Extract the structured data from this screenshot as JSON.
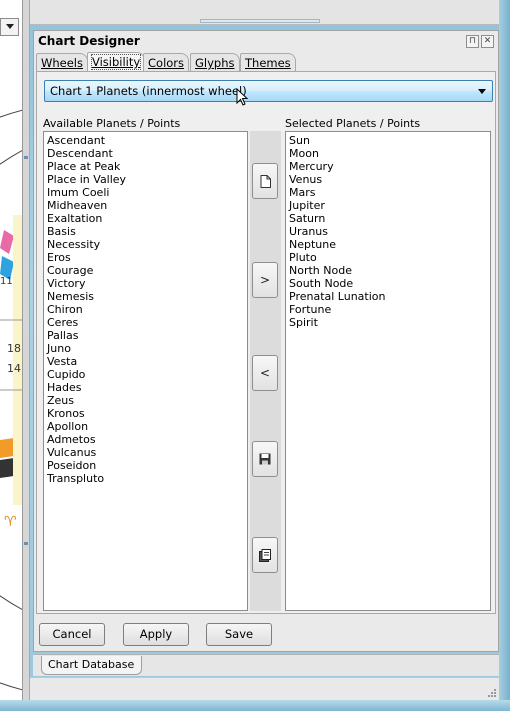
{
  "window": {
    "colors": {
      "frame": "#9bc8df",
      "select_accent": "#a7d9f5",
      "panel_bg": "#eaeaea"
    }
  },
  "background_chart": {
    "glyph_labels": [
      "11",
      "18",
      "14"
    ],
    "monkey_symbol": "♈"
  },
  "panel": {
    "title": "Chart Designer",
    "pin_icon": "pin-icon",
    "close_icon": "close-icon",
    "close_glyph": "✕",
    "pin_glyph": "⊓",
    "tabs": [
      {
        "label": "Wheels",
        "active": false
      },
      {
        "label": "Visibility",
        "active": true
      },
      {
        "label": "Colors",
        "active": false
      },
      {
        "label": "Glyphs",
        "active": false
      },
      {
        "label": "Themes",
        "active": false
      }
    ],
    "wheel_select": {
      "value": "Chart 1 Planets (innermost wheel)"
    },
    "available": {
      "label": "Available Planets / Points",
      "items": [
        "Ascendant",
        "Descendant",
        "Place at Peak",
        "Place in Valley",
        "Imum Coeli",
        "Midheaven",
        "Exaltation",
        "Basis",
        "Necessity",
        "Eros",
        "Courage",
        "Victory",
        "Nemesis",
        "Chiron",
        "Ceres",
        "Pallas",
        "Juno",
        "Vesta",
        "Cupido",
        "Hades",
        "Zeus",
        "Kronos",
        "Apollon",
        "Admetos",
        "Vulcanus",
        "Poseidon",
        "Transpluto"
      ]
    },
    "selected": {
      "label": "Selected Planets / Points",
      "items": [
        "Sun",
        "Moon",
        "Mercury",
        "Venus",
        "Mars",
        "Jupiter",
        "Saturn",
        "Uranus",
        "Neptune",
        "Pluto",
        "North Node",
        "South Node",
        "Prenatal Lunation",
        "Fortune",
        "Spirit"
      ]
    },
    "move_buttons": {
      "new_icon": "new-document-icon",
      "add_label": ">",
      "remove_label": "<",
      "save_icon": "floppy-disk-icon",
      "load_icon": "open-file-icon"
    },
    "buttons": {
      "cancel": "Cancel",
      "apply": "Apply",
      "save": "Save"
    }
  },
  "bottom_tabs": [
    {
      "label": "Chart Database"
    }
  ]
}
